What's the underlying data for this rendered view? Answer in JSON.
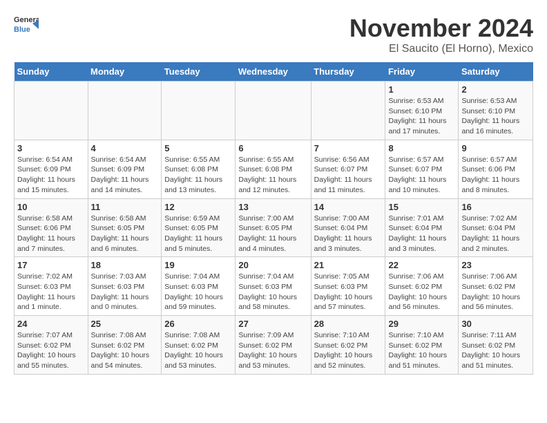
{
  "header": {
    "logo_general": "General",
    "logo_blue": "Blue",
    "month_year": "November 2024",
    "location": "El Saucito (El Horno), Mexico"
  },
  "weekdays": [
    "Sunday",
    "Monday",
    "Tuesday",
    "Wednesday",
    "Thursday",
    "Friday",
    "Saturday"
  ],
  "weeks": [
    [
      {
        "day": "",
        "info": ""
      },
      {
        "day": "",
        "info": ""
      },
      {
        "day": "",
        "info": ""
      },
      {
        "day": "",
        "info": ""
      },
      {
        "day": "",
        "info": ""
      },
      {
        "day": "1",
        "info": "Sunrise: 6:53 AM\nSunset: 6:10 PM\nDaylight: 11 hours and 17 minutes."
      },
      {
        "day": "2",
        "info": "Sunrise: 6:53 AM\nSunset: 6:10 PM\nDaylight: 11 hours and 16 minutes."
      }
    ],
    [
      {
        "day": "3",
        "info": "Sunrise: 6:54 AM\nSunset: 6:09 PM\nDaylight: 11 hours and 15 minutes."
      },
      {
        "day": "4",
        "info": "Sunrise: 6:54 AM\nSunset: 6:09 PM\nDaylight: 11 hours and 14 minutes."
      },
      {
        "day": "5",
        "info": "Sunrise: 6:55 AM\nSunset: 6:08 PM\nDaylight: 11 hours and 13 minutes."
      },
      {
        "day": "6",
        "info": "Sunrise: 6:55 AM\nSunset: 6:08 PM\nDaylight: 11 hours and 12 minutes."
      },
      {
        "day": "7",
        "info": "Sunrise: 6:56 AM\nSunset: 6:07 PM\nDaylight: 11 hours and 11 minutes."
      },
      {
        "day": "8",
        "info": "Sunrise: 6:57 AM\nSunset: 6:07 PM\nDaylight: 11 hours and 10 minutes."
      },
      {
        "day": "9",
        "info": "Sunrise: 6:57 AM\nSunset: 6:06 PM\nDaylight: 11 hours and 8 minutes."
      }
    ],
    [
      {
        "day": "10",
        "info": "Sunrise: 6:58 AM\nSunset: 6:06 PM\nDaylight: 11 hours and 7 minutes."
      },
      {
        "day": "11",
        "info": "Sunrise: 6:58 AM\nSunset: 6:05 PM\nDaylight: 11 hours and 6 minutes."
      },
      {
        "day": "12",
        "info": "Sunrise: 6:59 AM\nSunset: 6:05 PM\nDaylight: 11 hours and 5 minutes."
      },
      {
        "day": "13",
        "info": "Sunrise: 7:00 AM\nSunset: 6:05 PM\nDaylight: 11 hours and 4 minutes."
      },
      {
        "day": "14",
        "info": "Sunrise: 7:00 AM\nSunset: 6:04 PM\nDaylight: 11 hours and 3 minutes."
      },
      {
        "day": "15",
        "info": "Sunrise: 7:01 AM\nSunset: 6:04 PM\nDaylight: 11 hours and 3 minutes."
      },
      {
        "day": "16",
        "info": "Sunrise: 7:02 AM\nSunset: 6:04 PM\nDaylight: 11 hours and 2 minutes."
      }
    ],
    [
      {
        "day": "17",
        "info": "Sunrise: 7:02 AM\nSunset: 6:03 PM\nDaylight: 11 hours and 1 minute."
      },
      {
        "day": "18",
        "info": "Sunrise: 7:03 AM\nSunset: 6:03 PM\nDaylight: 11 hours and 0 minutes."
      },
      {
        "day": "19",
        "info": "Sunrise: 7:04 AM\nSunset: 6:03 PM\nDaylight: 10 hours and 59 minutes."
      },
      {
        "day": "20",
        "info": "Sunrise: 7:04 AM\nSunset: 6:03 PM\nDaylight: 10 hours and 58 minutes."
      },
      {
        "day": "21",
        "info": "Sunrise: 7:05 AM\nSunset: 6:03 PM\nDaylight: 10 hours and 57 minutes."
      },
      {
        "day": "22",
        "info": "Sunrise: 7:06 AM\nSunset: 6:02 PM\nDaylight: 10 hours and 56 minutes."
      },
      {
        "day": "23",
        "info": "Sunrise: 7:06 AM\nSunset: 6:02 PM\nDaylight: 10 hours and 56 minutes."
      }
    ],
    [
      {
        "day": "24",
        "info": "Sunrise: 7:07 AM\nSunset: 6:02 PM\nDaylight: 10 hours and 55 minutes."
      },
      {
        "day": "25",
        "info": "Sunrise: 7:08 AM\nSunset: 6:02 PM\nDaylight: 10 hours and 54 minutes."
      },
      {
        "day": "26",
        "info": "Sunrise: 7:08 AM\nSunset: 6:02 PM\nDaylight: 10 hours and 53 minutes."
      },
      {
        "day": "27",
        "info": "Sunrise: 7:09 AM\nSunset: 6:02 PM\nDaylight: 10 hours and 53 minutes."
      },
      {
        "day": "28",
        "info": "Sunrise: 7:10 AM\nSunset: 6:02 PM\nDaylight: 10 hours and 52 minutes."
      },
      {
        "day": "29",
        "info": "Sunrise: 7:10 AM\nSunset: 6:02 PM\nDaylight: 10 hours and 51 minutes."
      },
      {
        "day": "30",
        "info": "Sunrise: 7:11 AM\nSunset: 6:02 PM\nDaylight: 10 hours and 51 minutes."
      }
    ]
  ]
}
